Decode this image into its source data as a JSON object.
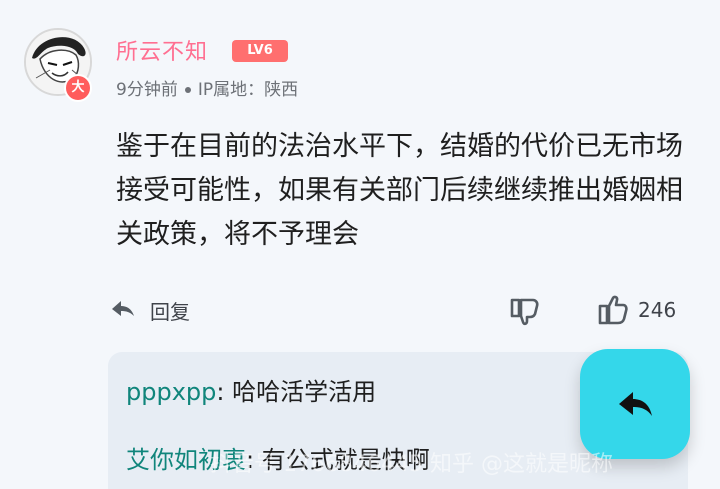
{
  "user": {
    "name": "所云不知",
    "level": "LV6",
    "badge": "大",
    "time": "9分钟前",
    "location": "IP属地：陕西"
  },
  "comment": {
    "text": "鉴于在目前的法治水平下，结婚的代价已无市场接受可能性，如果有关部门后续继续推出婚姻相关政策，将不予理会"
  },
  "actions": {
    "reply_label": "回复",
    "like_count": "246"
  },
  "sub_replies": [
    {
      "name": "pppxpp",
      "text": "哈哈活学活用"
    },
    {
      "name": "艾你如初衷",
      "text": "有公式就是快啊"
    }
  ],
  "watermark": "抖音号 1766846445  知乎 @这就是昵称"
}
